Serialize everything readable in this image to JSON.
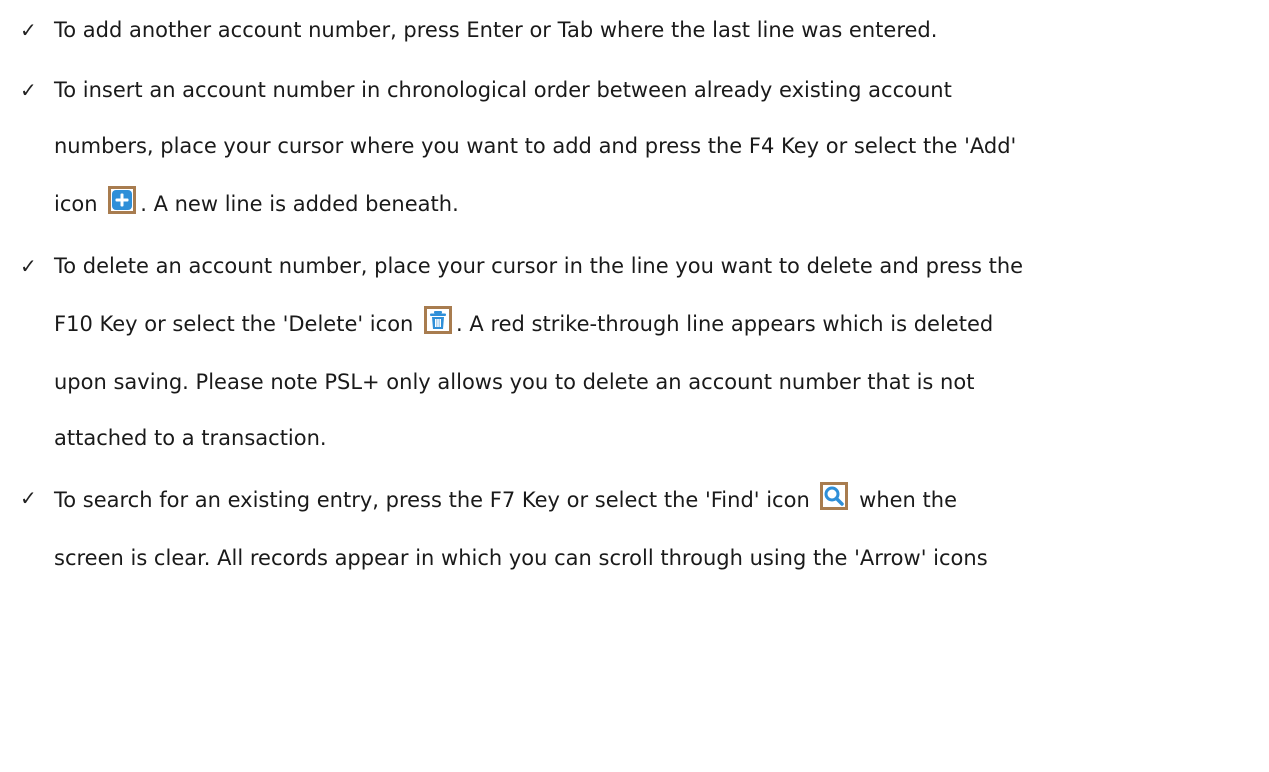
{
  "bullets": [
    {
      "lines": [
        "To add another account number, press Enter or Tab where the last line was entered."
      ]
    },
    {
      "lines": [
        "To insert an account number in chronological order between already existing account",
        "numbers, place your cursor where you want to add and press the F4 Key or select the 'Add'"
      ],
      "icon_before": "icon",
      "icon_after": ". A new line is added beneath.",
      "icon": "add-icon"
    },
    {
      "line1": "To delete an account number, place your cursor in the line you want to delete and press the",
      "line2_before": "F10 Key or select the 'Delete' icon",
      "line2_after": ".  A red strike-through line appears which is deleted",
      "line3": "upon saving. Please note PSL+ only allows you to delete an account number that is not",
      "line4": "attached to a transaction.",
      "icon": "trash-icon"
    },
    {
      "line1_before": "To search for an existing entry, press the F7 Key or select the 'Find' icon",
      "line1_after": "when the",
      "line2": "screen is clear.  All records appear in which you can scroll through using the 'Arrow' icons",
      "icon": "search-icon"
    }
  ],
  "check_glyph": "✓",
  "colors": {
    "icon_border": "#a87c4f",
    "icon_blue": "#2f8fd8"
  }
}
